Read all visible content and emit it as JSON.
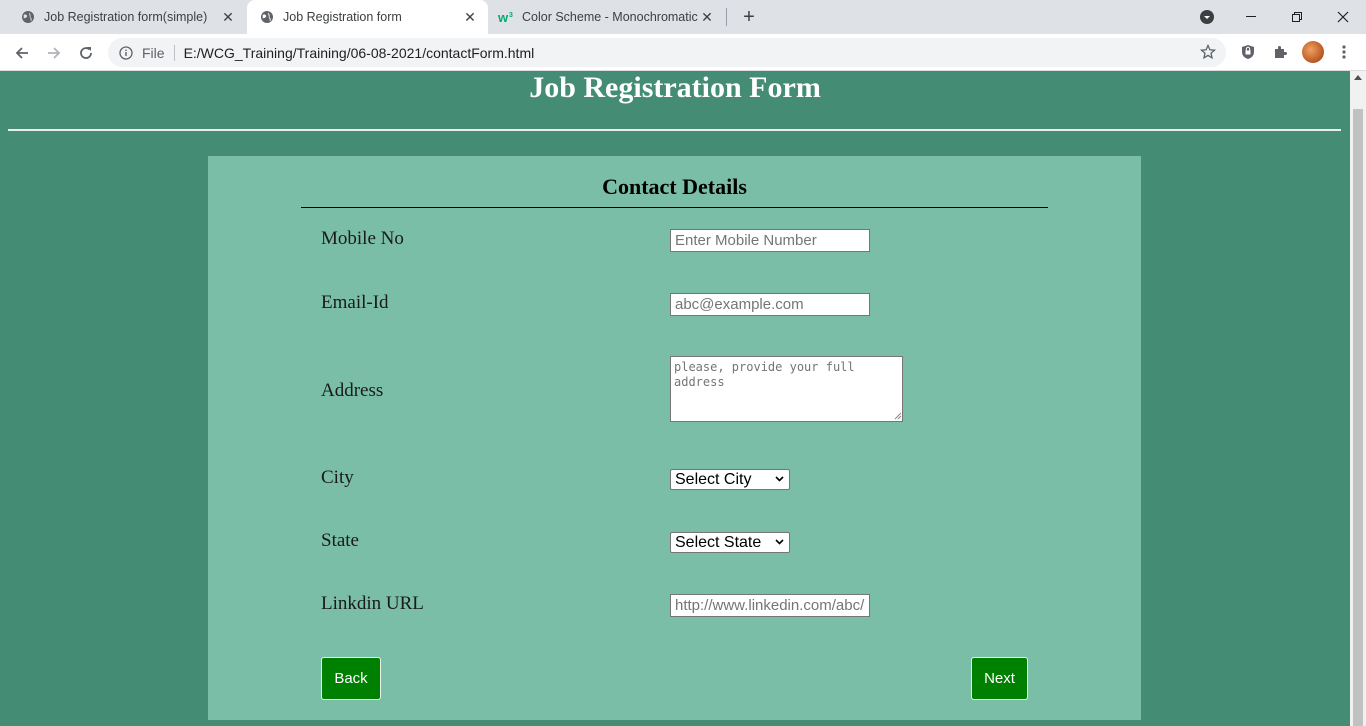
{
  "browser": {
    "tabs": [
      {
        "title": "Job Registration form(simple)",
        "favicon": "globe-icon",
        "active": false
      },
      {
        "title": "Job Registration form",
        "favicon": "globe-icon",
        "active": true
      },
      {
        "title": "Color Scheme - Monochromatic",
        "favicon": "w3schools-icon",
        "active": false
      }
    ],
    "address": {
      "scheme_label": "File",
      "url": "E:/WCG_Training/Training/06-08-2021/contactForm.html"
    }
  },
  "page": {
    "title": "Job Registration Form",
    "background": "#448c74",
    "card_background": "#7abea8",
    "section_title": "Contact Details",
    "fields": {
      "mobile": {
        "label": "Mobile No",
        "placeholder": "Enter Mobile Number",
        "value": ""
      },
      "email": {
        "label": "Email-Id",
        "placeholder": "abc@example.com",
        "value": ""
      },
      "address": {
        "label": "Address",
        "placeholder": "please, provide your full address",
        "value": ""
      },
      "city": {
        "label": "City",
        "selected": "Select City"
      },
      "state": {
        "label": "State",
        "selected": "Select State"
      },
      "linkedin": {
        "label": "Linkdin URL",
        "placeholder": "http://www.linkedin.com/abc/",
        "value": ""
      }
    },
    "buttons": {
      "back": "Back",
      "next": "Next",
      "color": "#008000"
    }
  }
}
